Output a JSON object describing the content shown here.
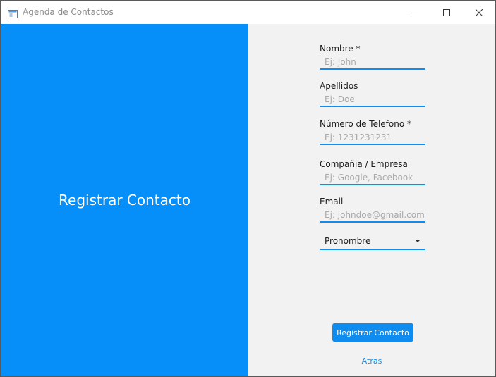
{
  "window": {
    "title": "Agenda de Contactos"
  },
  "colors": {
    "accent": "#0e8cf0",
    "left_panel": "#068ff8",
    "right_panel": "#f2f2f2"
  },
  "left_panel": {
    "title": "Registrar Contacto"
  },
  "form": {
    "fields": [
      {
        "label": "Nombre *",
        "value": "",
        "placeholder": "Ej: John"
      },
      {
        "label": "Apellidos",
        "value": "",
        "placeholder": "Ej: Doe"
      },
      {
        "label": "Número de Telefono *",
        "value": "",
        "placeholder": "Ej: 1231231231"
      },
      {
        "label": "Compañia / Empresa",
        "value": "",
        "placeholder": "Ej: Google, Facebook"
      },
      {
        "label": "Email",
        "value": "",
        "placeholder": "Ej: johndoe@gmail.com"
      }
    ],
    "pronoun_select": {
      "selected": "Pronombre",
      "icon": "chevron-down-icon"
    },
    "submit_label": "Registrar Contacto",
    "back_label": "Atras"
  },
  "icons": {
    "app": "app-window-icon",
    "minimize": "minimize-icon",
    "maximize": "maximize-icon",
    "close": "close-icon"
  }
}
